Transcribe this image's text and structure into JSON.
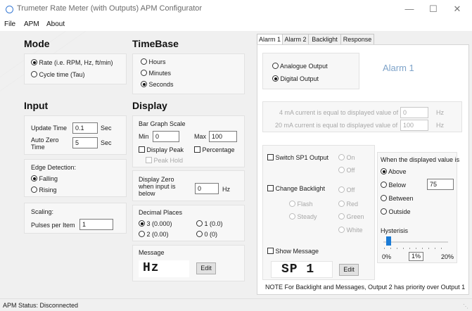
{
  "window": {
    "title": "Trumeter Rate Meter (with Outputs) APM Configurator",
    "minimize_icon": "minimize-icon",
    "maximize_icon": "maximize-icon",
    "close_icon": "close-icon"
  },
  "menu": {
    "items": [
      "File",
      "APM",
      "About"
    ]
  },
  "mode": {
    "title": "Mode",
    "options": [
      "Rate (i.e. RPM, Hz, ft/min)",
      "Cycle time (Tau)"
    ],
    "selected": 0
  },
  "timebase": {
    "title": "TimeBase",
    "options": [
      "Hours",
      "Minutes",
      "Seconds"
    ],
    "selected": 2
  },
  "input": {
    "title": "Input",
    "update_time_label": "Update Time",
    "update_time_value": "0.1",
    "update_time_unit": "Sec",
    "auto_zero_label_1": "Auto Zero",
    "auto_zero_label_2": "Time",
    "auto_zero_value": "5",
    "auto_zero_unit": "Sec",
    "edge_title": "Edge Detection:",
    "edge_options": [
      "Falling",
      "Rising"
    ],
    "edge_selected": 0,
    "scaling_title": "Scaling:",
    "pulses_label": "Pulses per Item",
    "pulses_value": "1"
  },
  "display": {
    "title": "Display",
    "bargraph_title": "Bar Graph Scale",
    "min_label": "Min",
    "min_value": "0",
    "max_label": "Max",
    "max_value": "100",
    "display_peak_label": "Display Peak",
    "percentage_label": "Percentage",
    "peak_hold_label": "Peak Hold",
    "zero_label_1": "Display Zero",
    "zero_label_2": "when input is",
    "zero_label_3": "below",
    "zero_value": "0",
    "zero_unit": "Hz",
    "decimal_title": "Decimal Places",
    "decimal_options": [
      "3 (0.000)",
      "1 (0.0)",
      "2 (0.00)",
      "0 (0)"
    ],
    "decimal_selected": 0,
    "message_title": "Message",
    "message_value": "Hz",
    "edit_label": "Edit"
  },
  "tabs": {
    "items": [
      "Alarm 1",
      "Alarm 2",
      "Backlight",
      "Response"
    ],
    "active": 0
  },
  "alarm": {
    "heading": "Alarm 1",
    "output_options": [
      "Analogue Output",
      "Digital Output"
    ],
    "output_selected": 1,
    "ma4_label": "4 mA current is equal to displayed value of",
    "ma4_value": "0",
    "ma4_unit": "Hz",
    "ma20_label": "20 mA current is equal to displayed value of",
    "ma20_value": "100",
    "ma20_unit": "Hz",
    "switch_sp1_label": "Switch SP1 Output",
    "sp1_options": [
      "On",
      "Off"
    ],
    "change_backlight_label": "Change Backlight",
    "backlight_mode_options": [
      "Flash",
      "Steady"
    ],
    "backlight_color_options": [
      "Off",
      "Red",
      "Green",
      "White"
    ],
    "show_message_label": "Show Message",
    "message_value": "SP 1",
    "edit_label": "Edit",
    "when_title": "When the displayed value is",
    "when_options": [
      "Above",
      "Below",
      "Between",
      "Outside"
    ],
    "when_selected": 0,
    "below_value": "75",
    "hysteresis_label": "Hysterisis",
    "hysteresis_min": "0%",
    "hysteresis_value": "1%",
    "hysteresis_max": "20%",
    "hysteresis_fraction": 0.05,
    "note": "NOTE  For Backlight and Messages, Output 2 has priority over Output 1"
  },
  "status": {
    "text": "APM Status:  Disconnected"
  }
}
